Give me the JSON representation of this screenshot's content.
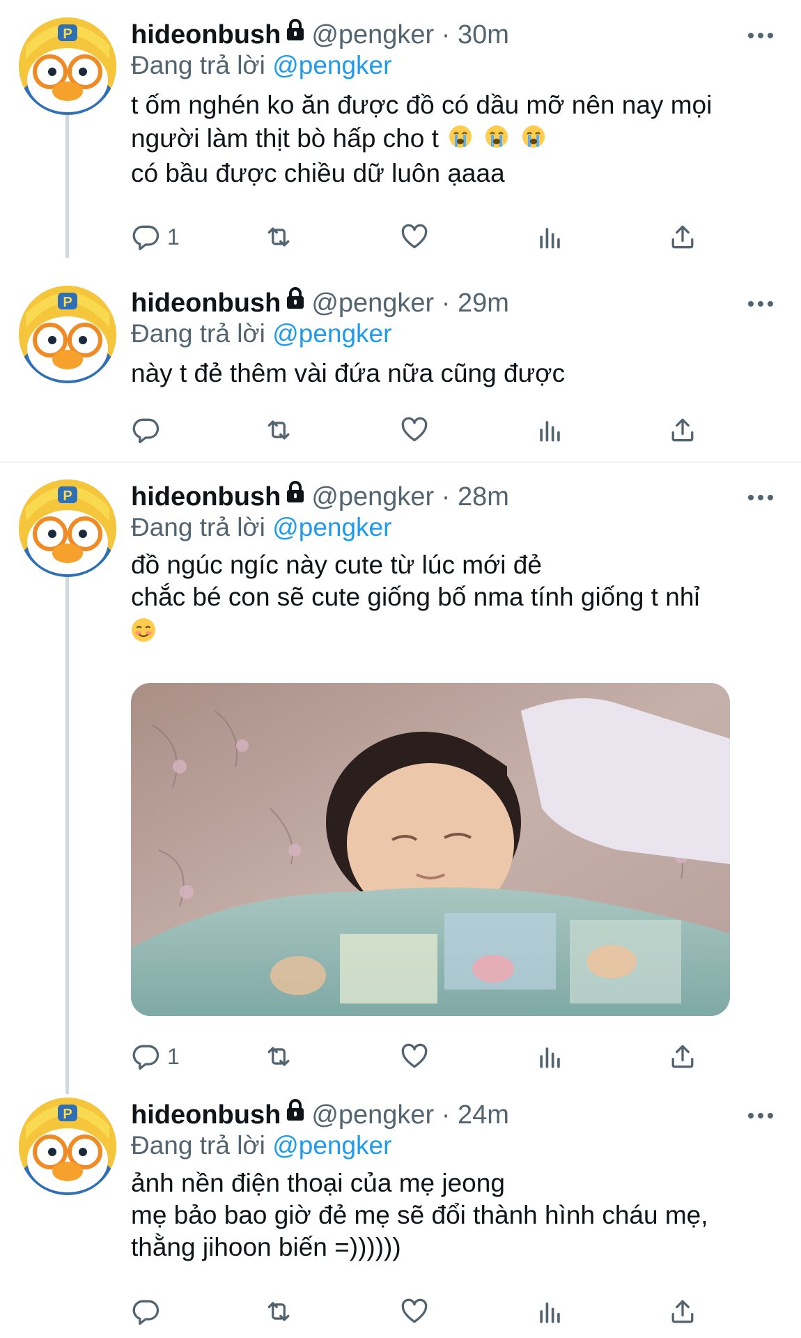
{
  "tweets": [
    {
      "name": "hideonbush",
      "handle": "@pengker",
      "dot": "·",
      "time": "30m",
      "reply_prefix": "Đang trả lời",
      "reply_to": "@pengker",
      "lines": [
        "t ốm nghén ko ăn được đồ có dầu mỡ nên nay mọi",
        "người làm thịt bò hấp cho t",
        "có bầu được chiều dữ luôn ạaaa"
      ],
      "reply_count": "1"
    },
    {
      "name": "hideonbush",
      "handle": "@pengker",
      "dot": "·",
      "time": "29m",
      "reply_prefix": "Đang trả lời",
      "reply_to": "@pengker",
      "lines": [
        "này t đẻ thêm vài đứa nữa cũng được"
      ],
      "reply_count": ""
    },
    {
      "name": "hideonbush",
      "handle": "@pengker",
      "dot": "·",
      "time": "28m",
      "reply_prefix": "Đang trả lời",
      "reply_to": "@pengker",
      "lines": [
        "đồ ngúc ngíc này cute từ lúc mới đẻ",
        "chắc bé con sẽ cute giống bố nma tính giống t nhỉ"
      ],
      "reply_count": "1"
    },
    {
      "name": "hideonbush",
      "handle": "@pengker",
      "dot": "·",
      "time": "24m",
      "reply_prefix": "Đang trả lời",
      "reply_to": "@pengker",
      "lines": [
        "ảnh nền điện thoại của mẹ jeong",
        "mẹ bảo bao giờ đẻ mẹ sẽ đổi thành hình cháu mẹ,",
        "thằng jihoon biến =))))))"
      ],
      "reply_count": ""
    }
  ],
  "icons": {
    "lock": "lock-icon",
    "more": "more-icon",
    "reply": "reply-icon",
    "retweet": "retweet-icon",
    "like": "like-icon",
    "views": "views-icon",
    "share": "share-icon",
    "crying_emoji": "crying-face-emoji",
    "smiling_emoji": "smiling-face-emoji"
  },
  "colors": {
    "link": "#1d9bf0",
    "secondary_text": "#536471",
    "thread_line": "#cfd9de"
  }
}
